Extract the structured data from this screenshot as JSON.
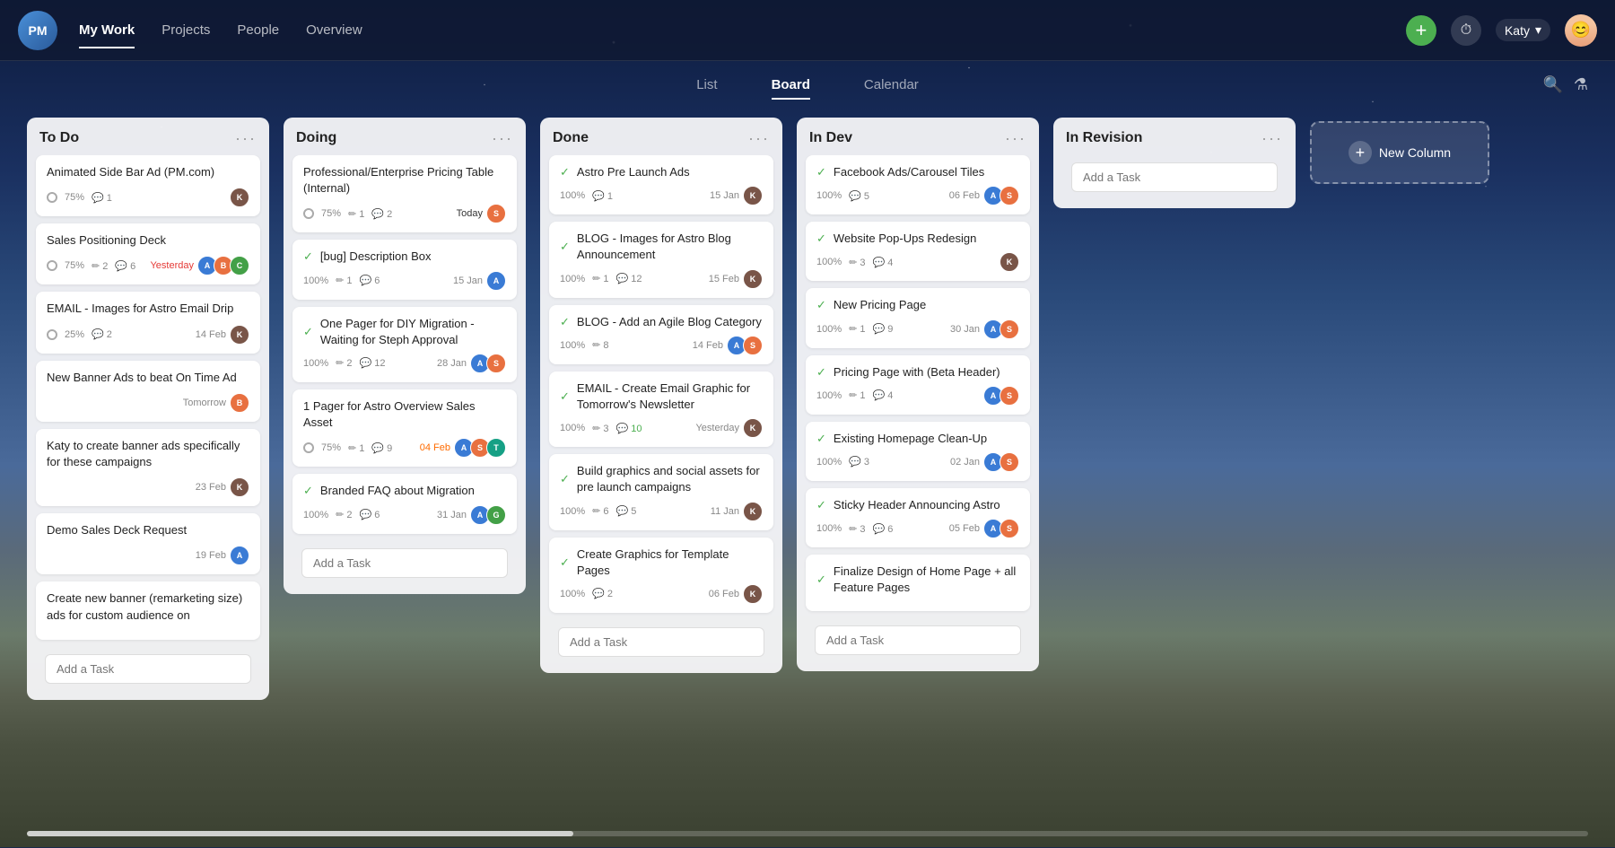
{
  "app": {
    "logo": "PM",
    "nav": {
      "items": [
        {
          "label": "My Work",
          "active": false
        },
        {
          "label": "Projects",
          "active": false
        },
        {
          "label": "People",
          "active": false
        },
        {
          "label": "Overview",
          "active": false
        }
      ],
      "active_item": "My Work"
    },
    "user": {
      "name": "Katy",
      "chevron": "▾"
    }
  },
  "view_tabs": {
    "tabs": [
      {
        "label": "List",
        "active": false
      },
      {
        "label": "Board",
        "active": true
      },
      {
        "label": "Calendar",
        "active": false
      }
    ]
  },
  "board": {
    "columns": [
      {
        "id": "todo",
        "title": "To Do",
        "cards": [
          {
            "title": "Animated Side Bar Ad (PM.com)",
            "progress": 75,
            "stats": {
              "edits": null,
              "comments": 1
            },
            "date": "",
            "date_class": "",
            "done": false,
            "avatars": [
              "av-brown"
            ]
          },
          {
            "title": "Sales Positioning Deck",
            "progress": 75,
            "stats": {
              "edits": 2,
              "comments": 6
            },
            "date": "Yesterday",
            "date_class": "overdue",
            "done": false,
            "avatars": [
              "av-blue",
              "av-orange",
              "av-green"
            ]
          },
          {
            "title": "EMAIL - Images for Astro Email Drip",
            "progress": 25,
            "stats": {
              "edits": null,
              "comments": 2
            },
            "date": "14 Feb",
            "date_class": "",
            "done": false,
            "avatars": [
              "av-brown"
            ]
          },
          {
            "title": "New Banner Ads to beat On Time Ad",
            "progress": null,
            "stats": {
              "edits": null,
              "comments": null
            },
            "date": "Tomorrow",
            "date_class": "",
            "done": false,
            "avatars": [
              "av-orange"
            ]
          },
          {
            "title": "Katy to create banner ads specifically for these campaigns",
            "progress": null,
            "stats": {
              "edits": null,
              "comments": null
            },
            "date": "23 Feb",
            "date_class": "",
            "done": false,
            "avatars": [
              "av-brown"
            ]
          },
          {
            "title": "Demo Sales Deck Request",
            "progress": null,
            "stats": {
              "edits": null,
              "comments": null
            },
            "date": "19 Feb",
            "date_class": "",
            "done": false,
            "avatars": [
              "av-blue"
            ]
          },
          {
            "title": "Create new banner (remarketing size) ads for custom audience on",
            "progress": null,
            "stats": {
              "edits": null,
              "comments": null
            },
            "date": "",
            "date_class": "",
            "done": false,
            "avatars": []
          }
        ],
        "add_task_placeholder": "Add a Task"
      },
      {
        "id": "doing",
        "title": "Doing",
        "cards": [
          {
            "title": "Professional/Enterprise Pricing Table (Internal)",
            "progress": 75,
            "stats": {
              "edits": 1,
              "comments": 2
            },
            "date": "Today",
            "date_class": "today",
            "done": false,
            "avatars": [
              "av-orange"
            ]
          },
          {
            "title": "[bug] Description Box",
            "progress": 100,
            "stats": {
              "edits": 1,
              "comments": 6
            },
            "date": "15 Jan",
            "date_class": "",
            "done": true,
            "avatars": [
              "av-blue"
            ]
          },
          {
            "title": "One Pager for DIY Migration - Waiting for Steph Approval",
            "progress": 100,
            "stats": {
              "edits": 2,
              "comments": 12
            },
            "date": "28 Jan",
            "date_class": "",
            "done": true,
            "avatars": [
              "av-blue",
              "av-orange"
            ]
          },
          {
            "title": "1 Pager for Astro Overview Sales Asset",
            "progress": 75,
            "stats": {
              "edits": 1,
              "comments": 9
            },
            "date": "04 Feb",
            "date_class": "orange",
            "done": false,
            "avatars": [
              "av-blue",
              "av-orange",
              "av-teal"
            ]
          },
          {
            "title": "Branded FAQ about Migration",
            "progress": 100,
            "stats": {
              "edits": 2,
              "comments": 6
            },
            "date": "31 Jan",
            "date_class": "",
            "done": true,
            "avatars": [
              "av-blue",
              "av-green"
            ]
          }
        ],
        "add_task_placeholder": "Add a Task"
      },
      {
        "id": "done",
        "title": "Done",
        "cards": [
          {
            "title": "Astro Pre Launch Ads",
            "progress": 100,
            "stats": {
              "edits": null,
              "comments": 1
            },
            "date": "15 Jan",
            "date_class": "",
            "done": true,
            "avatars": [
              "av-brown"
            ]
          },
          {
            "title": "BLOG - Images for Astro Blog Announcement",
            "progress": 100,
            "stats": {
              "edits": 1,
              "comments": 12
            },
            "date": "15 Feb",
            "date_class": "",
            "done": true,
            "avatars": [
              "av-brown"
            ]
          },
          {
            "title": "BLOG - Add an Agile Blog Category",
            "progress": 100,
            "stats": {
              "edits": 8,
              "comments": null
            },
            "date": "14 Feb",
            "date_class": "",
            "done": true,
            "avatars": [
              "av-blue",
              "av-orange"
            ]
          },
          {
            "title": "EMAIL - Create Email Graphic for Tomorrow's Newsletter",
            "progress": 100,
            "stats": {
              "edits": 3,
              "comments": 10
            },
            "date": "Yesterday",
            "date_class": "",
            "done": true,
            "avatars": [
              "av-brown"
            ]
          },
          {
            "title": "Build graphics and social assets for pre launch campaigns",
            "progress": 100,
            "stats": {
              "edits": 6,
              "comments": 5
            },
            "date": "11 Jan",
            "date_class": "",
            "done": true,
            "avatars": [
              "av-brown"
            ]
          },
          {
            "title": "Create Graphics for Template Pages",
            "progress": 100,
            "stats": {
              "edits": null,
              "comments": 2
            },
            "date": "06 Feb",
            "date_class": "",
            "done": true,
            "avatars": [
              "av-brown"
            ]
          }
        ],
        "add_task_placeholder": "Add a Task"
      },
      {
        "id": "indev",
        "title": "In Dev",
        "cards": [
          {
            "title": "Facebook Ads/Carousel Tiles",
            "progress": 100,
            "stats": {
              "edits": null,
              "comments": 5
            },
            "date": "06 Feb",
            "date_class": "",
            "done": true,
            "avatars": [
              "av-blue",
              "av-orange"
            ]
          },
          {
            "title": "Website Pop-Ups Redesign",
            "progress": 100,
            "stats": {
              "edits": 3,
              "comments": 4
            },
            "date": "",
            "date_class": "",
            "done": true,
            "avatars": [
              "av-brown"
            ]
          },
          {
            "title": "New Pricing Page",
            "progress": 100,
            "stats": {
              "edits": 1,
              "comments": 9
            },
            "date": "30 Jan",
            "date_class": "",
            "done": true,
            "avatars": [
              "av-blue",
              "av-orange"
            ]
          },
          {
            "title": "Pricing Page with (Beta Header)",
            "progress": 100,
            "stats": {
              "edits": 1,
              "comments": 4
            },
            "date": "",
            "date_class": "",
            "done": true,
            "avatars": [
              "av-blue",
              "av-orange"
            ]
          },
          {
            "title": "Existing Homepage Clean-Up",
            "progress": 100,
            "stats": {
              "edits": null,
              "comments": 3
            },
            "date": "02 Jan",
            "date_class": "",
            "done": true,
            "avatars": [
              "av-blue",
              "av-orange"
            ]
          },
          {
            "title": "Sticky Header Announcing Astro",
            "progress": 100,
            "stats": {
              "edits": 3,
              "comments": 6
            },
            "date": "05 Feb",
            "date_class": "",
            "done": true,
            "avatars": [
              "av-blue",
              "av-orange"
            ]
          },
          {
            "title": "Finalize Design of Home Page + all Feature Pages",
            "progress": 100,
            "stats": {
              "edits": null,
              "comments": null
            },
            "date": "",
            "date_class": "",
            "done": true,
            "avatars": []
          }
        ],
        "add_task_placeholder": "Add a Task"
      },
      {
        "id": "inrevision",
        "title": "In Revision",
        "cards": [],
        "add_task_placeholder": "Add a Task"
      }
    ],
    "new_column_label": "New Column"
  }
}
